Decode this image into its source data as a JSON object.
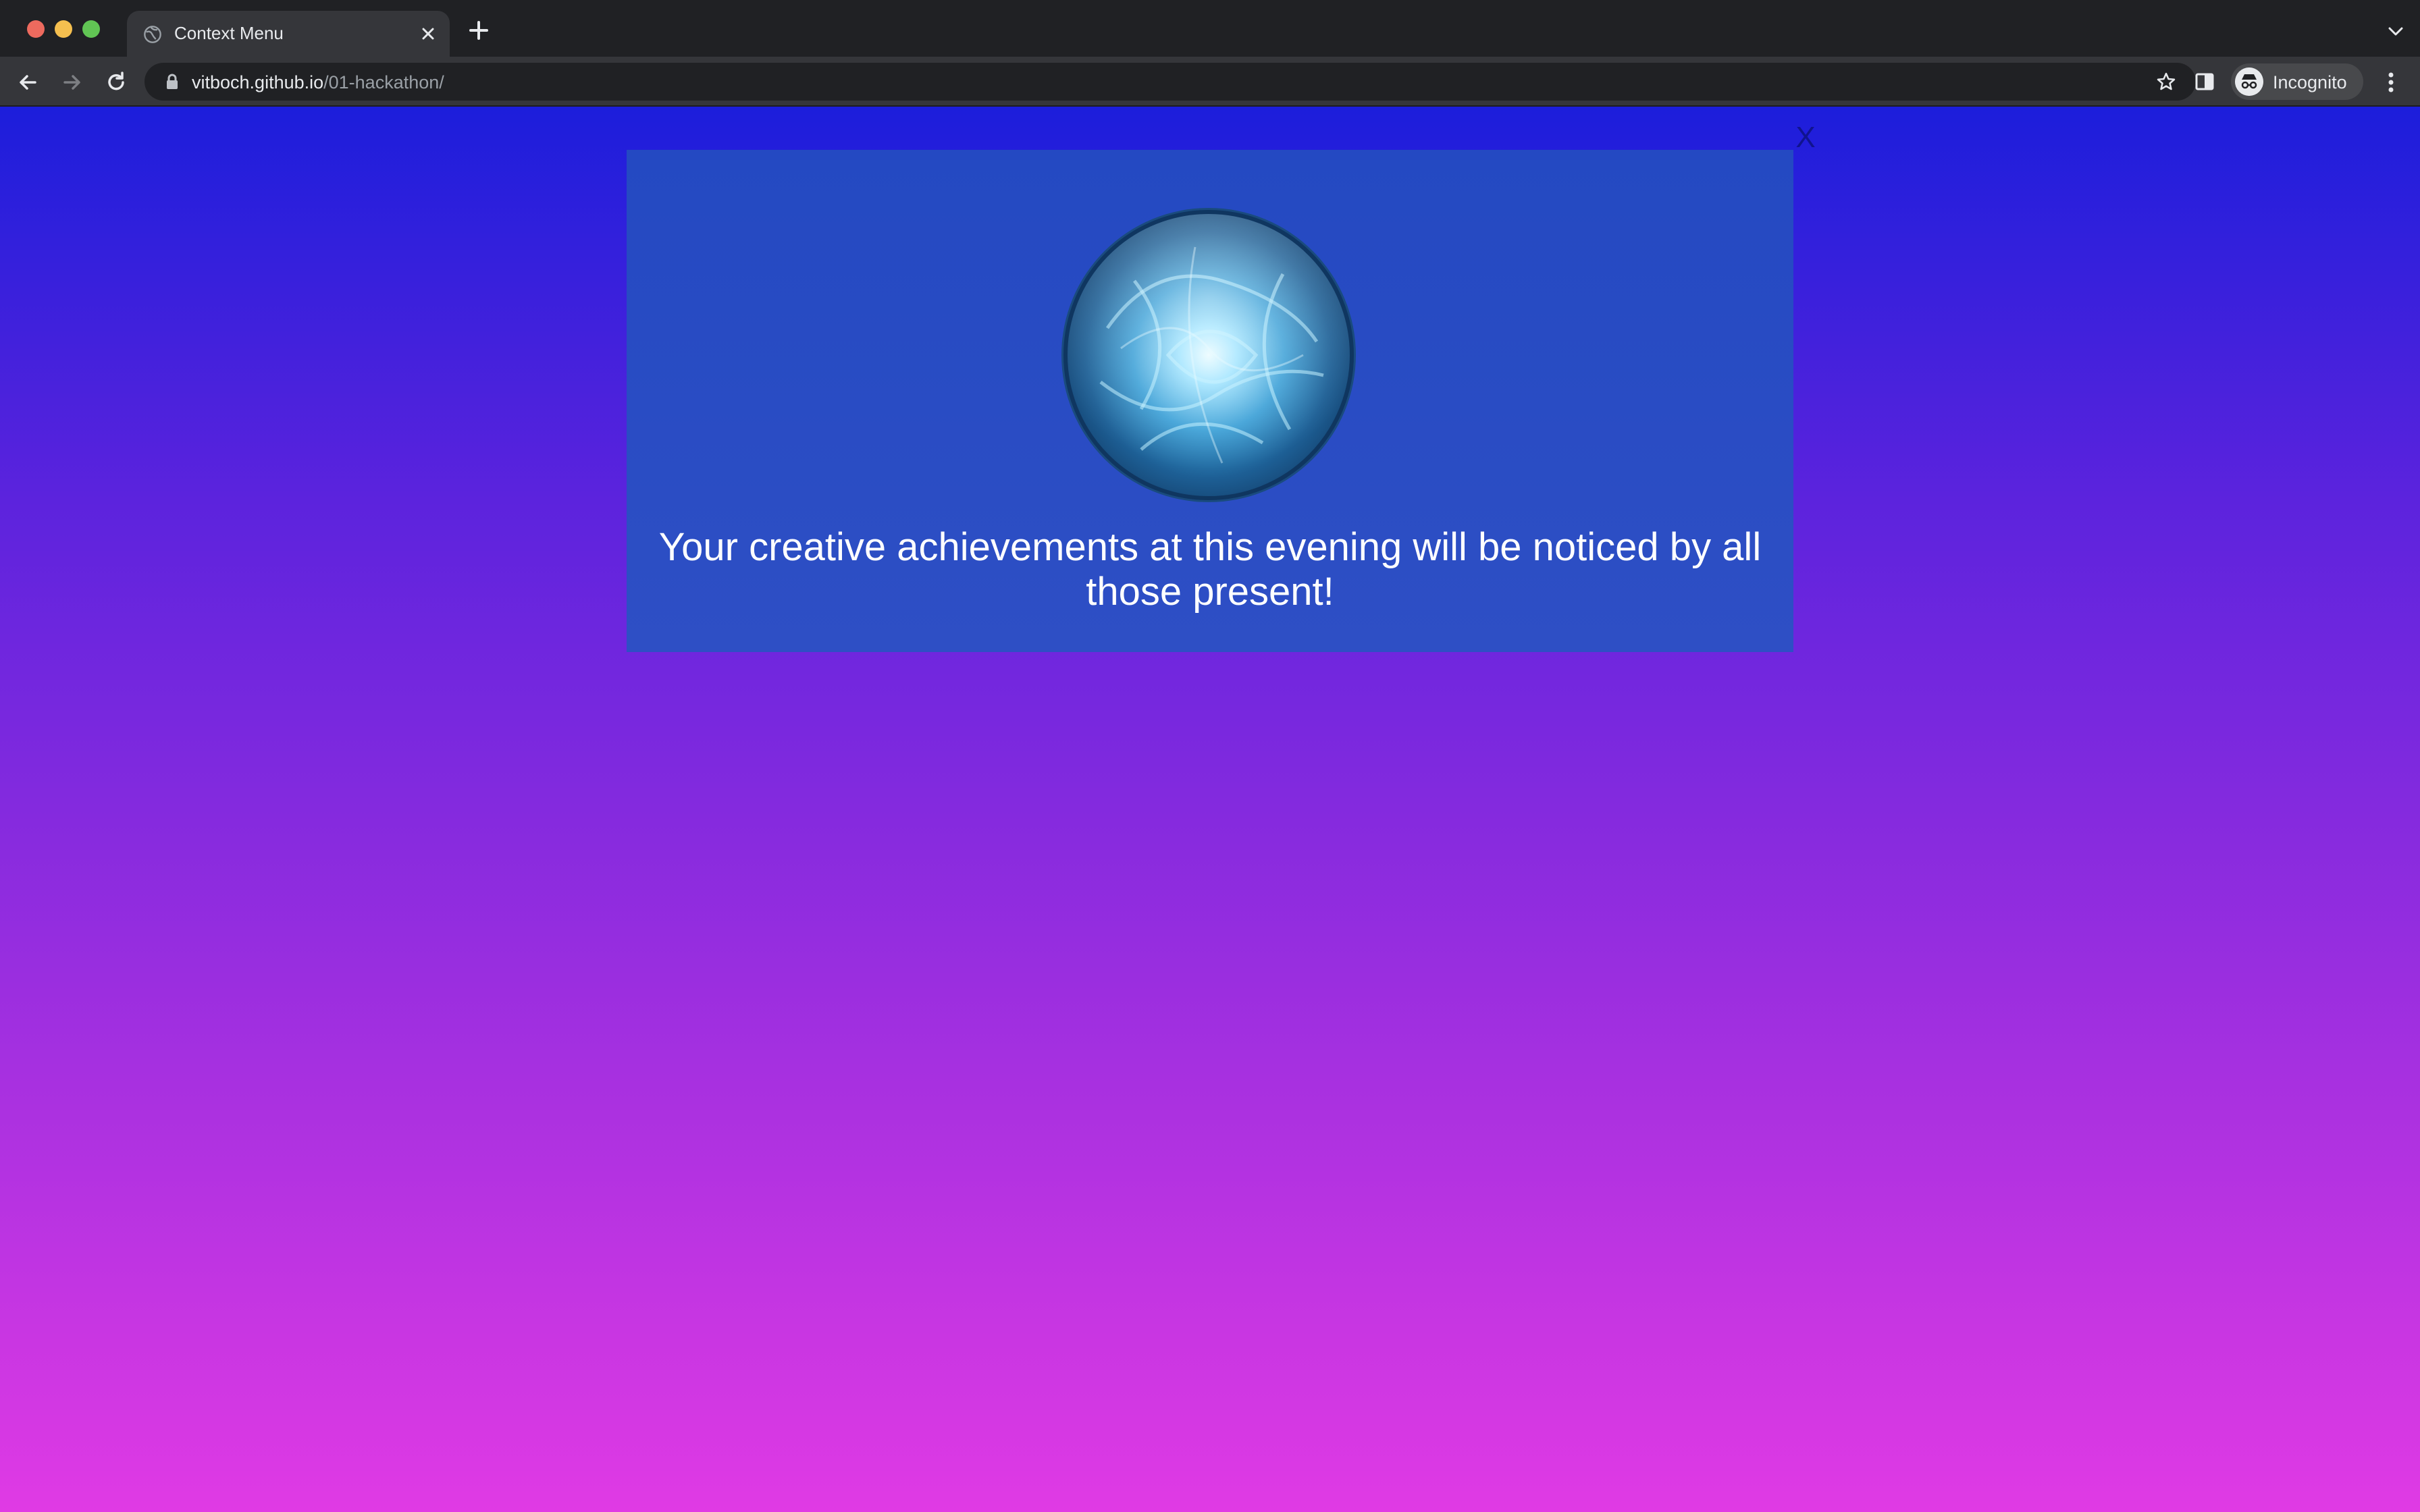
{
  "browser": {
    "tab": {
      "title": "Context Menu",
      "favicon": "globe-icon"
    },
    "address": {
      "host": "vitboch.github.io",
      "path": "/01-hackathon/"
    },
    "profile": {
      "label": "Incognito",
      "icon": "incognito-icon"
    }
  },
  "page": {
    "close_label": "X",
    "message": "Your creative achievements at this evening will be noticed by all those present!",
    "image": "crystal-orb",
    "colors": {
      "gradient_top": "#1c1edb",
      "gradient_bottom": "#e03ae4",
      "popup_bg": "#2449c2",
      "close_color": "#10138f"
    }
  }
}
